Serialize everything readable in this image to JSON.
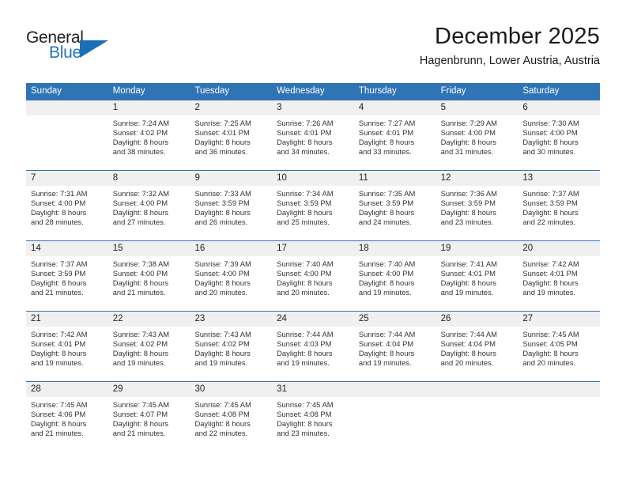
{
  "brand": {
    "name_top": "General",
    "name_bottom": "Blue",
    "triangle_color": "#1b6fb5",
    "top_color": "#231f20",
    "bottom_color": "#2276bd"
  },
  "header": {
    "title": "December 2025",
    "location": "Hagenbrunn, Lower Austria, Austria"
  },
  "theme": {
    "header_bg": "#2f74b5",
    "header_text": "#ffffff",
    "numband_bg": "#f0f0f0",
    "cell_bg": "#ffffff",
    "text": "#333333"
  },
  "weekdays": [
    "Sunday",
    "Monday",
    "Tuesday",
    "Wednesday",
    "Thursday",
    "Friday",
    "Saturday"
  ],
  "weeks": [
    [
      {
        "day": "",
        "lines": []
      },
      {
        "day": "1",
        "lines": [
          "Sunrise: 7:24 AM",
          "Sunset: 4:02 PM",
          "Daylight: 8 hours",
          "and 38 minutes."
        ]
      },
      {
        "day": "2",
        "lines": [
          "Sunrise: 7:25 AM",
          "Sunset: 4:01 PM",
          "Daylight: 8 hours",
          "and 36 minutes."
        ]
      },
      {
        "day": "3",
        "lines": [
          "Sunrise: 7:26 AM",
          "Sunset: 4:01 PM",
          "Daylight: 8 hours",
          "and 34 minutes."
        ]
      },
      {
        "day": "4",
        "lines": [
          "Sunrise: 7:27 AM",
          "Sunset: 4:01 PM",
          "Daylight: 8 hours",
          "and 33 minutes."
        ]
      },
      {
        "day": "5",
        "lines": [
          "Sunrise: 7:29 AM",
          "Sunset: 4:00 PM",
          "Daylight: 8 hours",
          "and 31 minutes."
        ]
      },
      {
        "day": "6",
        "lines": [
          "Sunrise: 7:30 AM",
          "Sunset: 4:00 PM",
          "Daylight: 8 hours",
          "and 30 minutes."
        ]
      }
    ],
    [
      {
        "day": "7",
        "lines": [
          "Sunrise: 7:31 AM",
          "Sunset: 4:00 PM",
          "Daylight: 8 hours",
          "and 28 minutes."
        ]
      },
      {
        "day": "8",
        "lines": [
          "Sunrise: 7:32 AM",
          "Sunset: 4:00 PM",
          "Daylight: 8 hours",
          "and 27 minutes."
        ]
      },
      {
        "day": "9",
        "lines": [
          "Sunrise: 7:33 AM",
          "Sunset: 3:59 PM",
          "Daylight: 8 hours",
          "and 26 minutes."
        ]
      },
      {
        "day": "10",
        "lines": [
          "Sunrise: 7:34 AM",
          "Sunset: 3:59 PM",
          "Daylight: 8 hours",
          "and 25 minutes."
        ]
      },
      {
        "day": "11",
        "lines": [
          "Sunrise: 7:35 AM",
          "Sunset: 3:59 PM",
          "Daylight: 8 hours",
          "and 24 minutes."
        ]
      },
      {
        "day": "12",
        "lines": [
          "Sunrise: 7:36 AM",
          "Sunset: 3:59 PM",
          "Daylight: 8 hours",
          "and 23 minutes."
        ]
      },
      {
        "day": "13",
        "lines": [
          "Sunrise: 7:37 AM",
          "Sunset: 3:59 PM",
          "Daylight: 8 hours",
          "and 22 minutes."
        ]
      }
    ],
    [
      {
        "day": "14",
        "lines": [
          "Sunrise: 7:37 AM",
          "Sunset: 3:59 PM",
          "Daylight: 8 hours",
          "and 21 minutes."
        ]
      },
      {
        "day": "15",
        "lines": [
          "Sunrise: 7:38 AM",
          "Sunset: 4:00 PM",
          "Daylight: 8 hours",
          "and 21 minutes."
        ]
      },
      {
        "day": "16",
        "lines": [
          "Sunrise: 7:39 AM",
          "Sunset: 4:00 PM",
          "Daylight: 8 hours",
          "and 20 minutes."
        ]
      },
      {
        "day": "17",
        "lines": [
          "Sunrise: 7:40 AM",
          "Sunset: 4:00 PM",
          "Daylight: 8 hours",
          "and 20 minutes."
        ]
      },
      {
        "day": "18",
        "lines": [
          "Sunrise: 7:40 AM",
          "Sunset: 4:00 PM",
          "Daylight: 8 hours",
          "and 19 minutes."
        ]
      },
      {
        "day": "19",
        "lines": [
          "Sunrise: 7:41 AM",
          "Sunset: 4:01 PM",
          "Daylight: 8 hours",
          "and 19 minutes."
        ]
      },
      {
        "day": "20",
        "lines": [
          "Sunrise: 7:42 AM",
          "Sunset: 4:01 PM",
          "Daylight: 8 hours",
          "and 19 minutes."
        ]
      }
    ],
    [
      {
        "day": "21",
        "lines": [
          "Sunrise: 7:42 AM",
          "Sunset: 4:01 PM",
          "Daylight: 8 hours",
          "and 19 minutes."
        ]
      },
      {
        "day": "22",
        "lines": [
          "Sunrise: 7:43 AM",
          "Sunset: 4:02 PM",
          "Daylight: 8 hours",
          "and 19 minutes."
        ]
      },
      {
        "day": "23",
        "lines": [
          "Sunrise: 7:43 AM",
          "Sunset: 4:02 PM",
          "Daylight: 8 hours",
          "and 19 minutes."
        ]
      },
      {
        "day": "24",
        "lines": [
          "Sunrise: 7:44 AM",
          "Sunset: 4:03 PM",
          "Daylight: 8 hours",
          "and 19 minutes."
        ]
      },
      {
        "day": "25",
        "lines": [
          "Sunrise: 7:44 AM",
          "Sunset: 4:04 PM",
          "Daylight: 8 hours",
          "and 19 minutes."
        ]
      },
      {
        "day": "26",
        "lines": [
          "Sunrise: 7:44 AM",
          "Sunset: 4:04 PM",
          "Daylight: 8 hours",
          "and 20 minutes."
        ]
      },
      {
        "day": "27",
        "lines": [
          "Sunrise: 7:45 AM",
          "Sunset: 4:05 PM",
          "Daylight: 8 hours",
          "and 20 minutes."
        ]
      }
    ],
    [
      {
        "day": "28",
        "lines": [
          "Sunrise: 7:45 AM",
          "Sunset: 4:06 PM",
          "Daylight: 8 hours",
          "and 21 minutes."
        ]
      },
      {
        "day": "29",
        "lines": [
          "Sunrise: 7:45 AM",
          "Sunset: 4:07 PM",
          "Daylight: 8 hours",
          "and 21 minutes."
        ]
      },
      {
        "day": "30",
        "lines": [
          "Sunrise: 7:45 AM",
          "Sunset: 4:08 PM",
          "Daylight: 8 hours",
          "and 22 minutes."
        ]
      },
      {
        "day": "31",
        "lines": [
          "Sunrise: 7:45 AM",
          "Sunset: 4:08 PM",
          "Daylight: 8 hours",
          "and 23 minutes."
        ]
      },
      {
        "day": "",
        "lines": []
      },
      {
        "day": "",
        "lines": []
      },
      {
        "day": "",
        "lines": []
      }
    ]
  ]
}
